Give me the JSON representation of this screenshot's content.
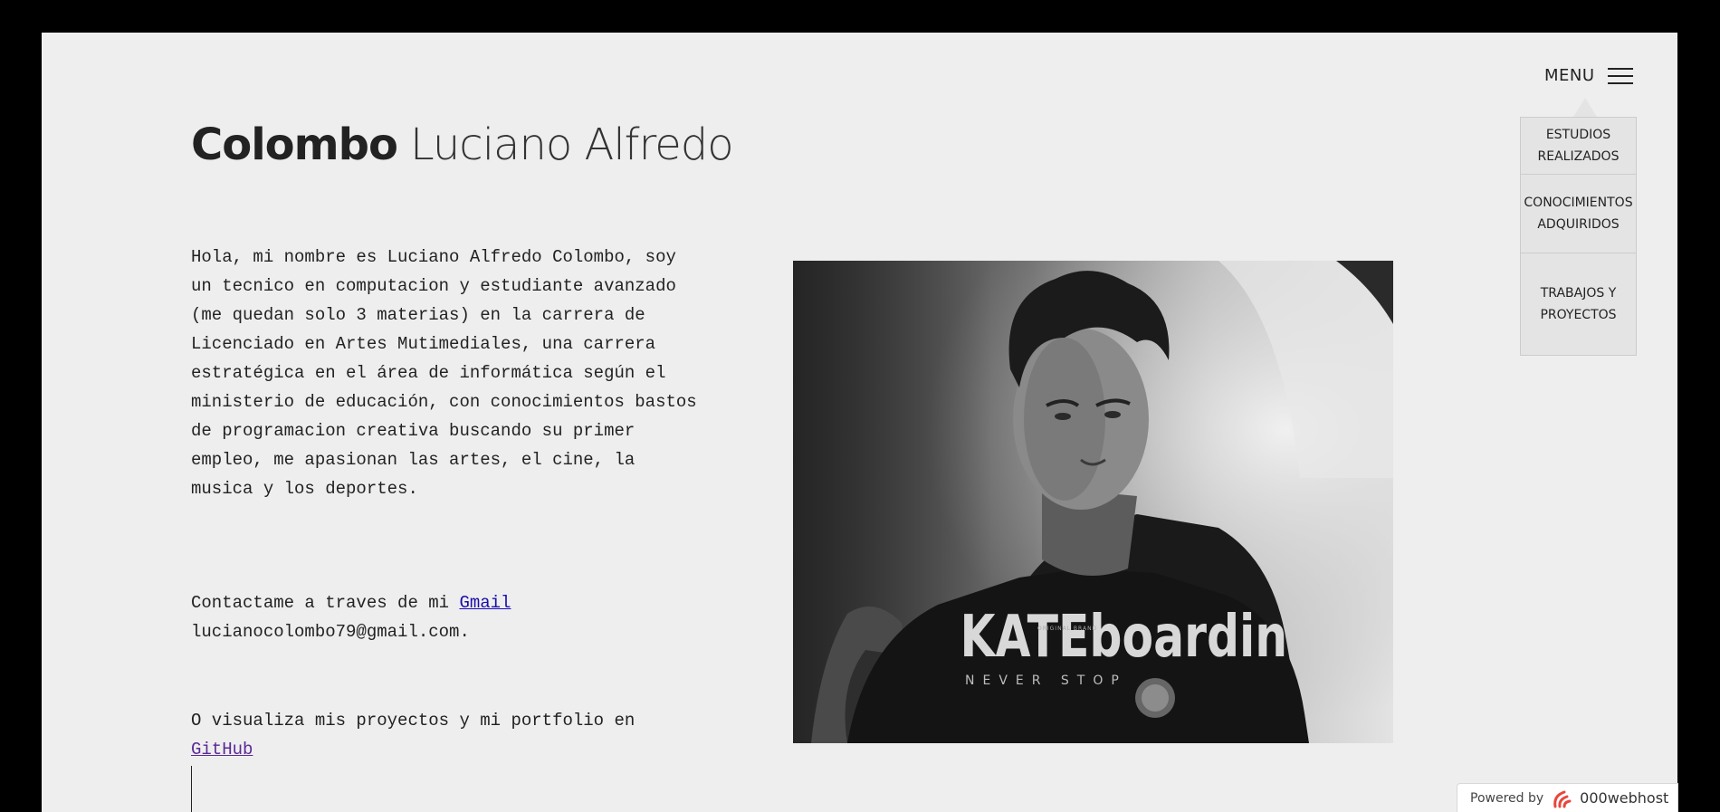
{
  "header": {
    "title_last": "Colombo",
    "title_first": "Luciano Alfredo"
  },
  "intro": {
    "bio": "Hola, mi nombre es Luciano Alfredo Colombo, soy un tecnico en computacion y estudiante avanzado (me quedan solo 3 materias) en la carrera de Licenciado en Artes Mutimediales, una carrera estratégica en el área de informática según el ministerio de educación, con conocimientos bastos de programacion creativa buscando su primer empleo, me apasionan las artes, el cine, la musica y los deportes.",
    "contact_prefix": "Contactame a traves de mi ",
    "contact_link": "Gmail",
    "email": "lucianocolombo79@gmail.com.",
    "portfolio_prefix": "O visualiza mis proyectos y mi portfolio en",
    "portfolio_link": "GitHub"
  },
  "menu": {
    "label": "MENU",
    "items": [
      {
        "line1": "ESTUDIOS",
        "line2": "REALIZADOS"
      },
      {
        "line1": "CONOCIMIENTOS",
        "line2": "ADQUIRIDOS"
      },
      {
        "line1": "TRABAJOS Y",
        "line2": "PROYECTOS"
      }
    ]
  },
  "photo": {
    "shirt_text": "KATEboardin",
    "shirt_subtext": "NEVER STOP",
    "shirt_small": "ORIGINAL BRAND"
  },
  "badge": {
    "powered": "Powered by",
    "host": "000webhost"
  },
  "colors": {
    "background": "#eeeeee",
    "frame": "#000000",
    "text": "#222222",
    "link": "#1a0dab",
    "link_visited": "#5a2a96"
  }
}
